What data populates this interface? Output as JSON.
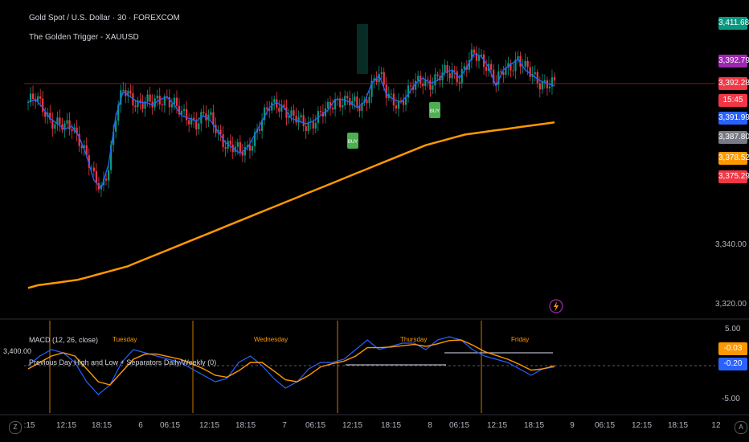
{
  "header": {
    "symbol_title": "Gold Spot / U.S. Dollar · 30 · FOREXCOM",
    "indicator_title": "The Golden Trigger - XAUUSD"
  },
  "price_tags": [
    {
      "label": "3,411.68",
      "color": "#089981"
    },
    {
      "label": "3,392.79",
      "color": "#9c27b0"
    },
    {
      "label": "3,392.28",
      "color": "#f23645"
    },
    {
      "label": "15:45",
      "color": "#f23645"
    },
    {
      "label": "3,391.99",
      "color": "#2962ff"
    },
    {
      "label": "3,387.80",
      "color": "#787b86"
    },
    {
      "label": "3,378.52",
      "color": "#ff9800"
    },
    {
      "label": "3,375.29",
      "color": "#f23645"
    }
  ],
  "price_axis": {
    "labels": [
      "3,340.00",
      "3,320.00"
    ]
  },
  "lower_pane": {
    "macd_label": "MACD (12, 26, close)",
    "separator_label": "Previous Day High and Low + Separators Daily/Weekly (0)",
    "left_value": "3,400.00",
    "axis_labels": [
      "5.00",
      "-5.00"
    ],
    "value_tags": [
      {
        "label": "-0.03",
        "color": "#ff9800"
      },
      {
        "label": "-0.20",
        "color": "#2962ff"
      }
    ],
    "day_labels": [
      "Tuesday",
      "Wednesday",
      "Thursday",
      "Friday"
    ]
  },
  "time_axis": {
    "labels": [
      ":15",
      "12:15",
      "18:15",
      "6",
      "06:15",
      "12:15",
      "18:15",
      "7",
      "06:15",
      "12:15",
      "18:15",
      "8",
      "06:15",
      "12:15",
      "18:15",
      "9",
      "06:15",
      "12:15",
      "18:15",
      "12"
    ]
  },
  "signals": [
    {
      "label": "BUY"
    },
    {
      "label": "BUY"
    }
  ],
  "corner_buttons": {
    "left": "Z",
    "right": "A"
  },
  "colors": {
    "bull": "#089981",
    "bear": "#f23645",
    "fast_ma": "#2962ff",
    "slow_ma": "#ff9800",
    "signal": "#4caf50",
    "macd": "#2962ff",
    "macd_signal": "#ff9800"
  },
  "chart_data": [
    {
      "type": "line",
      "title": "Gold Spot / U.S. Dollar · 30 · FOREXCOM",
      "ylim": [
        3312,
        3418
      ],
      "series": [
        {
          "values": [
            3386,
            3387,
            3384,
            3380,
            3378,
            3376,
            3377,
            3373,
            3366,
            3357,
            3354,
            3363,
            3381,
            3390,
            3388,
            3386,
            3386,
            3385,
            3387,
            3388,
            3385,
            3381,
            3380,
            3379,
            3381,
            3379,
            3375,
            3371,
            3369,
            3367,
            3369,
            3374,
            3379,
            3384,
            3386,
            3384,
            3380,
            3379,
            3378,
            3379,
            3381,
            3383,
            3387,
            3387,
            3386,
            3384,
            3386,
            3393,
            3396,
            3389,
            3387,
            3386,
            3389,
            3393,
            3395,
            3393,
            3394,
            3397,
            3398,
            3395,
            3399,
            3404,
            3403,
            3399,
            3392,
            3398,
            3400,
            3402,
            3398,
            3396,
            3394,
            3393,
            3392
          ]
        },
        {
          "values": [
            3317,
            3318,
            3318.5,
            3319,
            3319.5,
            3320,
            3321,
            3322,
            3323,
            3324,
            3325,
            3326.5,
            3328,
            3329.5,
            3331,
            3332.5,
            3334,
            3335.5,
            3337,
            3338.5,
            3340,
            3341.5,
            3343,
            3344.5,
            3346,
            3347.5,
            3349,
            3350.5,
            3352,
            3353.5,
            3355,
            3356.5,
            3358,
            3359.5,
            3361,
            3362.5,
            3364,
            3365.5,
            3367,
            3368.5,
            3370,
            3371,
            3372,
            3373,
            3374,
            3374.5,
            3375,
            3375.5,
            3376,
            3376.5,
            3377,
            3377.5,
            3378,
            3378.5
          ]
        }
      ]
    },
    {
      "type": "line",
      "ylim": [
        -6,
        6
      ],
      "series": [
        {
          "values": [
            0,
            1.5,
            2.5,
            2.0,
            0.5,
            -2.5,
            -4.5,
            -3.0,
            0.5,
            2.5,
            2.0,
            1.5,
            1.0,
            0.5,
            -0.5,
            -1.5,
            -2.5,
            -2.0,
            0.5,
            1.5,
            0,
            -2.0,
            -3.5,
            -2.5,
            -0.5,
            0.5,
            0.5,
            1.0,
            2.5,
            4.0,
            2.5,
            3.0,
            3.5,
            3.5,
            2.5,
            4.0,
            4.5,
            4.0,
            2.5,
            1.5,
            1.0,
            0.5,
            -0.5,
            -1.5,
            -0.5,
            -0.2
          ]
        },
        {
          "values": [
            -0.5,
            0.5,
            1.5,
            2.0,
            1.5,
            -0.5,
            -2.5,
            -3.0,
            -1.0,
            1.0,
            1.8,
            1.8,
            1.4,
            1.0,
            0.3,
            -0.5,
            -1.5,
            -1.8,
            -0.8,
            0.5,
            0.5,
            -0.8,
            -2.2,
            -2.5,
            -1.5,
            -0.2,
            0.3,
            0.7,
            1.5,
            2.8,
            2.8,
            2.9,
            3.1,
            3.3,
            3.0,
            3.4,
            3.9,
            4.0,
            3.2,
            2.2,
            1.6,
            1.0,
            0.2,
            -0.7,
            -0.5,
            -0.03
          ]
        }
      ]
    }
  ]
}
